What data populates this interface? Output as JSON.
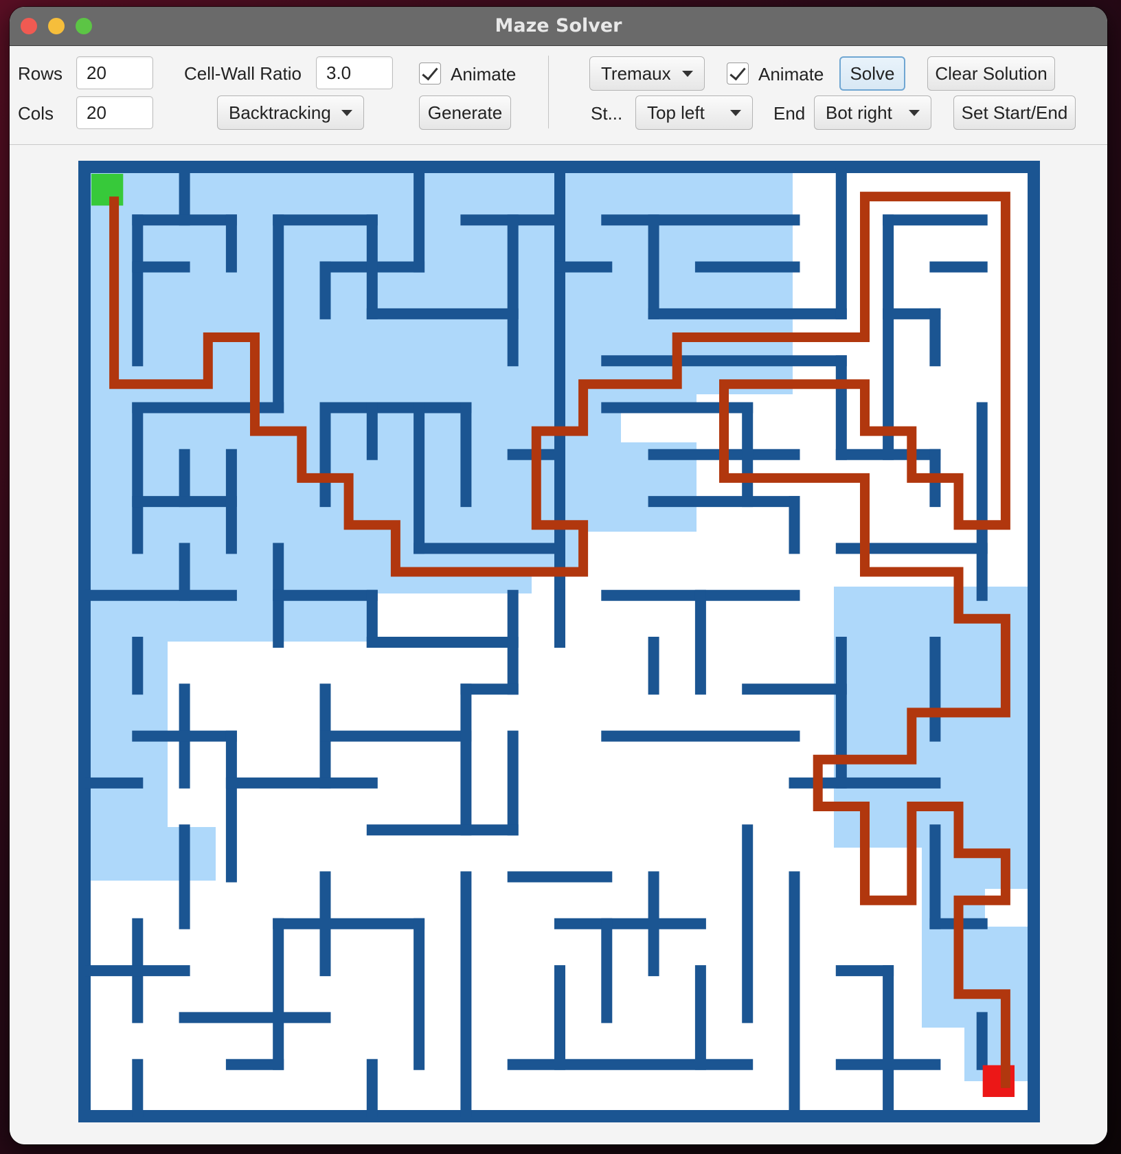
{
  "window": {
    "title": "Maze Solver"
  },
  "generator": {
    "rows_label": "Rows",
    "rows_value": "20",
    "cols_label": "Cols",
    "cols_value": "20",
    "ratio_label": "Cell-Wall Ratio",
    "ratio_value": "3.0",
    "animate_label": "Animate",
    "animate_checked": true,
    "algorithm": "Backtracking",
    "generate_label": "Generate"
  },
  "solver": {
    "algorithm": "Tremaux",
    "animate_label": "Animate",
    "animate_checked": true,
    "solve_label": "Solve",
    "clear_label": "Clear Solution",
    "start_label": "St...",
    "start_value": "Top left",
    "end_label": "End",
    "end_value": "Bot right",
    "set_label": "Set Start/End"
  },
  "maze": {
    "rows": 20,
    "cols": 20,
    "colors": {
      "wall": "#1b5592",
      "visited": "#aed8fa",
      "open": "#ffffff",
      "path": "#b1370e",
      "start": "#37c93a",
      "end": "#ec1717"
    },
    "start_cell": [
      0,
      0
    ],
    "end_cell": [
      19,
      19
    ]
  }
}
